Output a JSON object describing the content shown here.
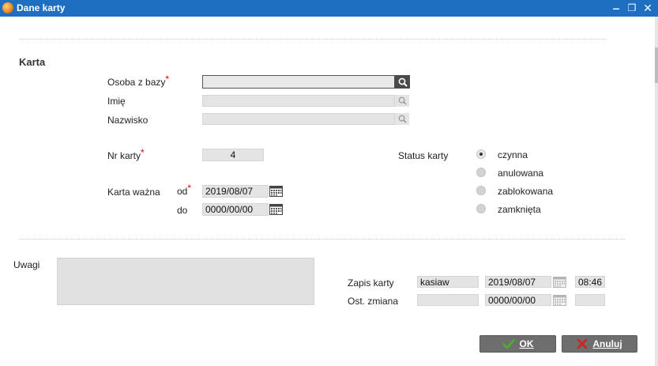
{
  "window": {
    "title": "Dane karty",
    "minimize_glyph": "‒",
    "restore_glyph": "❐",
    "close_glyph": "✕"
  },
  "section": {
    "title": "Karta"
  },
  "person": {
    "osoba_label": "Osoba z bazy",
    "osoba_value": "",
    "imie_label": "Imię",
    "imie_value": "",
    "nazwisko_label": "Nazwisko",
    "nazwisko_value": ""
  },
  "required_mark": "*",
  "card": {
    "nr_label": "Nr karty",
    "nr_value": "4",
    "valid_label": "Karta ważna",
    "od_label": "od",
    "od_value": "2019/08/07",
    "do_label": "do",
    "do_value": "0000/00/00"
  },
  "status": {
    "label": "Status karty",
    "options": [
      "czynna",
      "anulowana",
      "zablokowana",
      "zamknięta"
    ],
    "selected": "czynna"
  },
  "notes": {
    "label": "Uwagi",
    "value": ""
  },
  "record": {
    "zapis_label": "Zapis karty",
    "zapis_user": "kasiaw",
    "zapis_date": "2019/08/07",
    "zapis_time": "08:46",
    "zmiana_label": "Ost. zmiana",
    "zmiana_user": "",
    "zmiana_date": "0000/00/00",
    "zmiana_time": ""
  },
  "buttons": {
    "ok_label": "OK",
    "cancel_label": "Anuluj"
  },
  "icons": {
    "search": "magnifier-icon",
    "calendar": "calendar-icon",
    "ok": "checkmark-icon",
    "cancel": "x-mark-icon"
  },
  "colors": {
    "titlebar": "#1e6fc1",
    "button_bg": "#6e6e6e",
    "ok_check": "#4caf2a",
    "cancel_x": "#d62020",
    "required": "#dd0000"
  }
}
